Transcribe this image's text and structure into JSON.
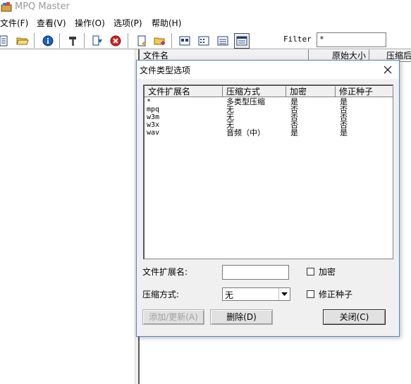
{
  "app": {
    "title": "MPQ Master"
  },
  "menu": [
    "文件(F)",
    "查看(V)",
    "操作(O)",
    "选项(P)",
    "帮助(H)"
  ],
  "filter": {
    "label": "Filter",
    "value": "*"
  },
  "main_columns": [
    "文件名",
    "原始大小",
    "压缩后"
  ],
  "dialog": {
    "title": "文件类型选项",
    "columns": [
      "文件扩展名",
      "压缩方式",
      "加密",
      "修正种子"
    ],
    "rows": [
      [
        "*",
        "多类型压缩",
        "是",
        "是"
      ],
      [
        "mpq",
        "无",
        "否",
        "否"
      ],
      [
        "w3m",
        "无",
        "否",
        "否"
      ],
      [
        "w3x",
        "无",
        "否",
        "否"
      ],
      [
        "wav",
        "音频（中）",
        "是",
        "是"
      ]
    ],
    "ext_label": "文件扩展名:",
    "ext_value": "",
    "compress_label": "压缩方式:",
    "compress_value": "无",
    "encrypt_label": "加密",
    "encrypt_checked": false,
    "fixseed_label": "修正种子",
    "fixseed_checked": false,
    "add_button": "添加/更新(A)",
    "delete_button": "删除(D)",
    "close_button": "关闭(C)"
  },
  "colors": {
    "accent": "#4c88c7",
    "dialog_bg": "#f0f0f0",
    "disabled_text": "#a0a0a0"
  }
}
